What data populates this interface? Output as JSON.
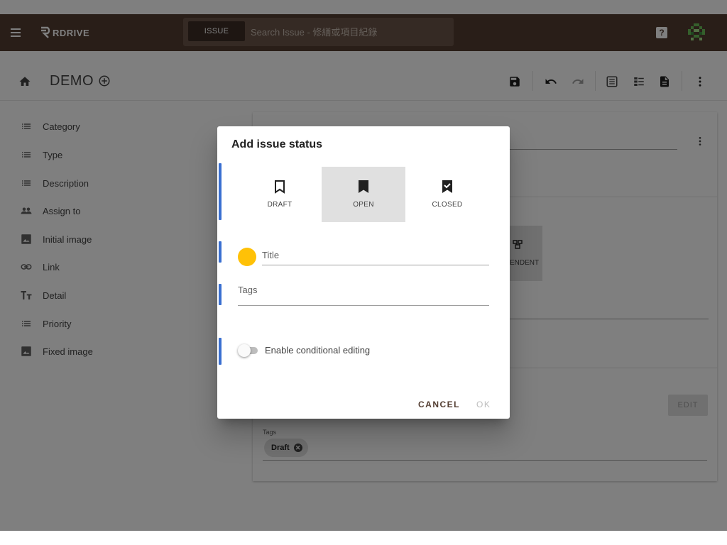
{
  "appbar": {
    "logo_text": "RDRIVE",
    "search_chip": "ISSUE",
    "search_placeholder": "Search Issue - 修繕或項目紀錄",
    "help_label": "?"
  },
  "toolbar": {
    "title": "DEMO",
    "icons": [
      "save-icon",
      "undo-icon",
      "redo-icon",
      "list-view-icon",
      "detail-view-icon",
      "document-icon",
      "more-vertical-icon"
    ]
  },
  "sidebar": {
    "items": [
      {
        "label": "Category",
        "icon": "list-icon"
      },
      {
        "label": "Type",
        "icon": "list-icon"
      },
      {
        "label": "Description",
        "icon": "list-icon"
      },
      {
        "label": "Assign to",
        "icon": "people-icon"
      },
      {
        "label": "Initial image",
        "icon": "image-icon"
      },
      {
        "label": "Link",
        "icon": "link-icon"
      },
      {
        "label": "Detail",
        "icon": "text-format-icon"
      },
      {
        "label": "Priority",
        "icon": "list-icon"
      },
      {
        "label": "Fixed image",
        "icon": "image-icon"
      }
    ]
  },
  "background_card": {
    "component_label": "ENDENT",
    "edit_label": "EDIT",
    "tags_label": "Tags",
    "tag_chip": "Draft"
  },
  "dialog": {
    "title": "Add issue status",
    "statuses": [
      {
        "label": "DRAFT",
        "icon": "bookmark-outline-icon",
        "selected": false
      },
      {
        "label": "OPEN",
        "icon": "bookmark-icon",
        "selected": true
      },
      {
        "label": "CLOSED",
        "icon": "bookmark-check-icon",
        "selected": false
      }
    ],
    "title_field_label": "Title",
    "title_field_value": "",
    "tags_field_label": "Tags",
    "toggle_label": "Enable conditional editing",
    "toggle_on": false,
    "cancel_label": "CANCEL",
    "ok_label": "OK",
    "colors": {
      "dot": "#ffc107",
      "accent": "#3a6fd1",
      "appbar": "#533d31"
    }
  }
}
